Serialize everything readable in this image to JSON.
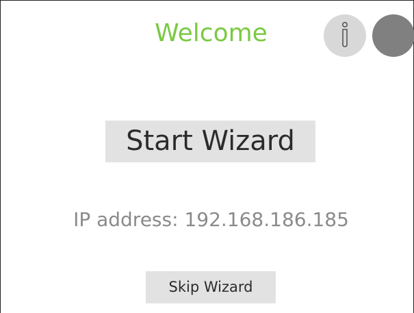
{
  "header": {
    "title": "Welcome",
    "info_icon": "info-icon",
    "status_indicator_color": "#808080"
  },
  "main": {
    "start_button_label": "Start Wizard",
    "ip_label": "IP address:",
    "ip_value": "192.168.186.185",
    "skip_button_label": "Skip Wizard"
  },
  "colors": {
    "title": "#7ac943",
    "button_background": "#e2e2e2",
    "info_button_background": "#d8d8d8",
    "ip_text": "#8a8a8a"
  }
}
